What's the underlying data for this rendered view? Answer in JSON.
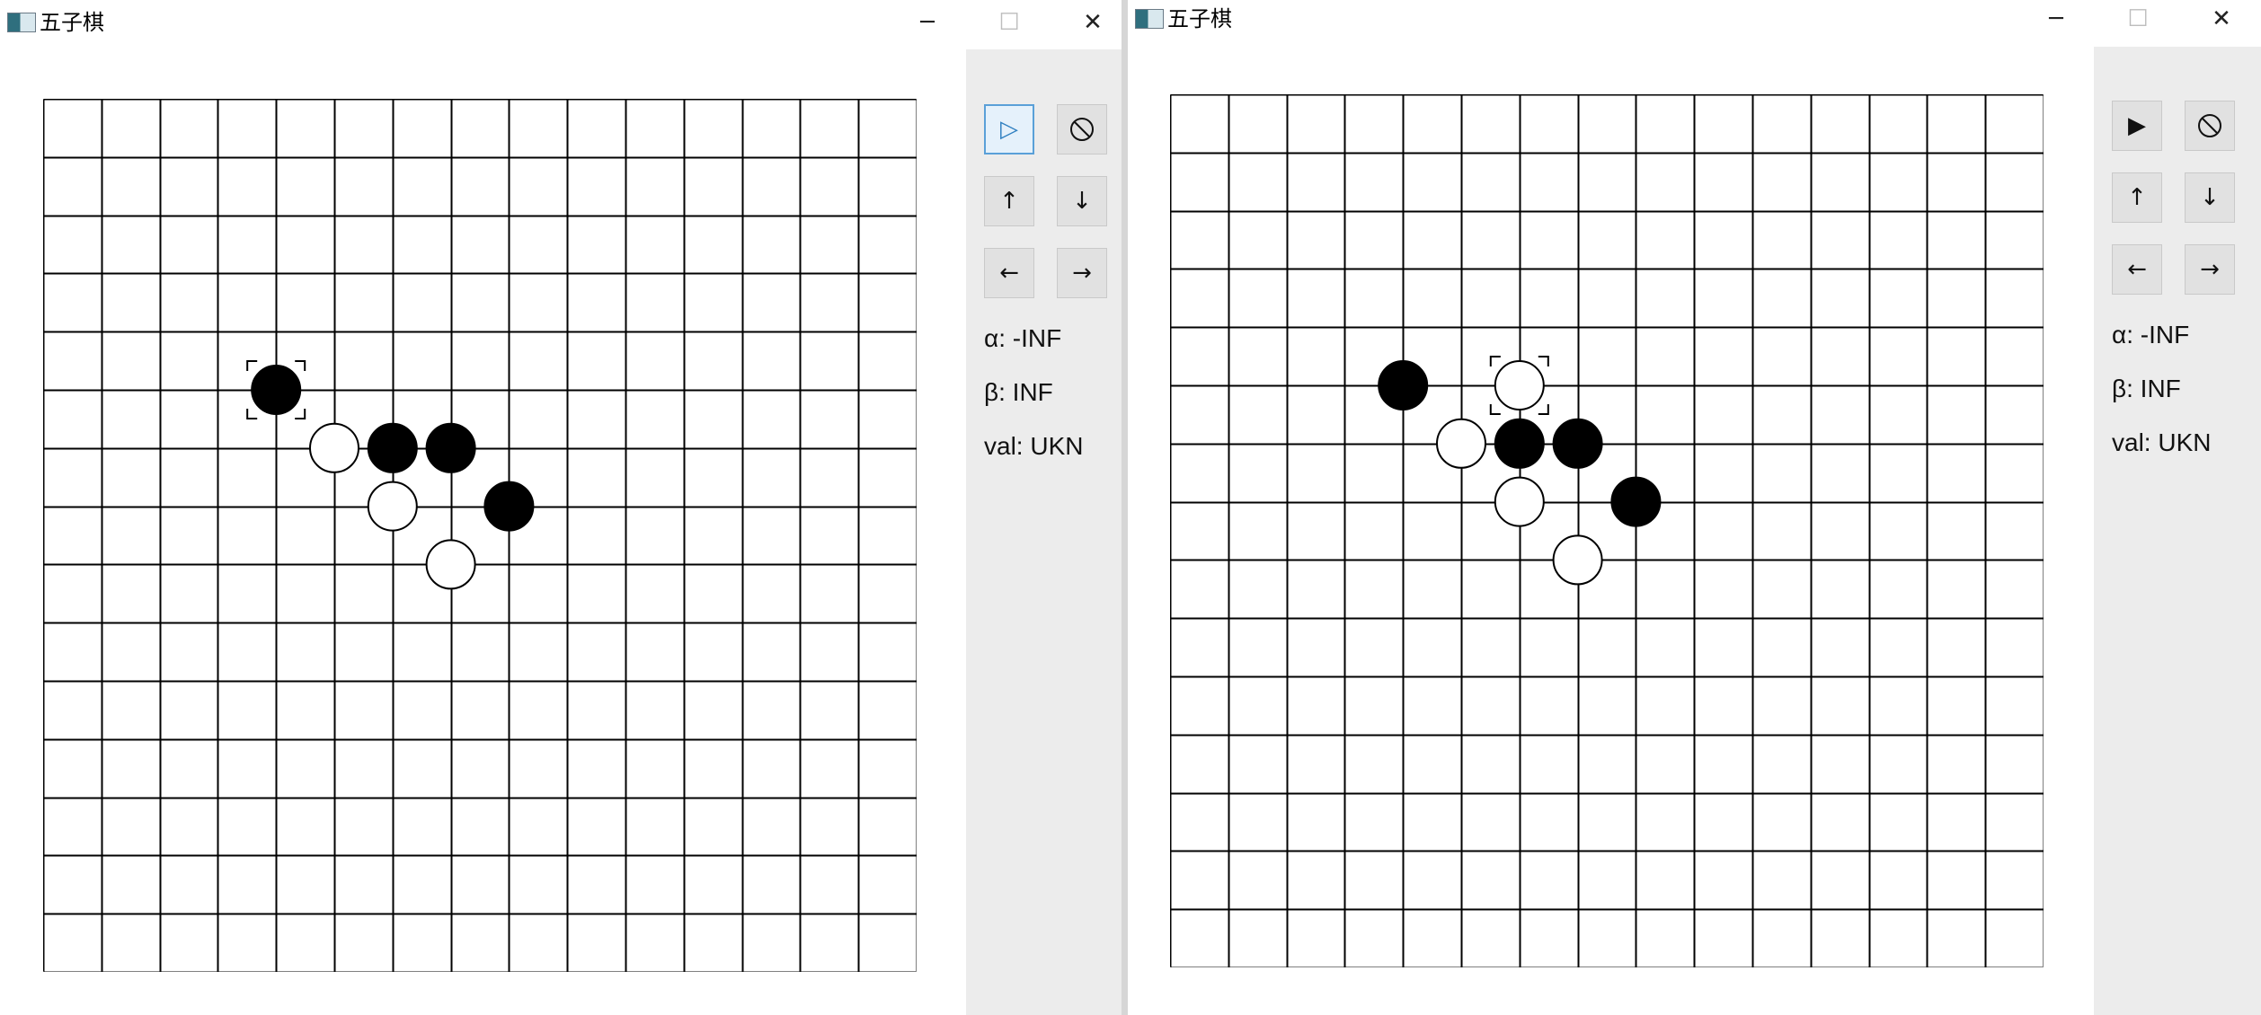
{
  "windows": [
    {
      "title": "五子棋",
      "controls": {
        "minimize": "─",
        "maximize": "☐",
        "close": "✕"
      },
      "panel": {
        "buttons": [
          {
            "name": "play-button",
            "icon": "play-outline-icon",
            "label": "▷",
            "focused": true
          },
          {
            "name": "stop-button",
            "icon": "prohibited-icon",
            "label": "",
            "focused": false
          },
          {
            "name": "up-button",
            "icon": "arrow-up-icon",
            "label": "↑",
            "focused": false
          },
          {
            "name": "down-button",
            "icon": "arrow-down-icon",
            "label": "↓",
            "focused": false
          },
          {
            "name": "left-button",
            "icon": "arrow-left-icon",
            "label": "←",
            "focused": false
          },
          {
            "name": "right-button",
            "icon": "arrow-right-icon",
            "label": "→",
            "focused": false
          }
        ],
        "alpha": "α: -INF",
        "beta": "β: INF",
        "val": "val: UKN"
      },
      "board": {
        "size": 15,
        "stones": [
          {
            "col": 4,
            "row": 5,
            "color": "black"
          },
          {
            "col": 5,
            "row": 6,
            "color": "white"
          },
          {
            "col": 6,
            "row": 6,
            "color": "black"
          },
          {
            "col": 7,
            "row": 6,
            "color": "black"
          },
          {
            "col": 6,
            "row": 7,
            "color": "white"
          },
          {
            "col": 8,
            "row": 7,
            "color": "black"
          },
          {
            "col": 7,
            "row": 8,
            "color": "white"
          }
        ],
        "last_move": {
          "col": 4,
          "row": 5
        }
      }
    },
    {
      "title": "五子棋",
      "controls": {
        "minimize": "─",
        "maximize": "☐",
        "close": "✕"
      },
      "panel": {
        "buttons": [
          {
            "name": "play-button",
            "icon": "play-filled-icon",
            "label": "▶",
            "focused": false
          },
          {
            "name": "stop-button",
            "icon": "prohibited-icon",
            "label": "",
            "focused": false
          },
          {
            "name": "up-button",
            "icon": "arrow-up-icon",
            "label": "↑",
            "focused": false
          },
          {
            "name": "down-button",
            "icon": "arrow-down-icon",
            "label": "↓",
            "focused": false
          },
          {
            "name": "left-button",
            "icon": "arrow-left-icon",
            "label": "←",
            "focused": false
          },
          {
            "name": "right-button",
            "icon": "arrow-right-icon",
            "label": "→",
            "focused": false
          }
        ],
        "alpha": "α: -INF",
        "beta": "β: INF",
        "val": "val: UKN"
      },
      "board": {
        "size": 15,
        "stones": [
          {
            "col": 4,
            "row": 5,
            "color": "black"
          },
          {
            "col": 6,
            "row": 5,
            "color": "white"
          },
          {
            "col": 5,
            "row": 6,
            "color": "white"
          },
          {
            "col": 6,
            "row": 6,
            "color": "black"
          },
          {
            "col": 7,
            "row": 6,
            "color": "black"
          },
          {
            "col": 6,
            "row": 7,
            "color": "white"
          },
          {
            "col": 8,
            "row": 7,
            "color": "black"
          },
          {
            "col": 7,
            "row": 8,
            "color": "white"
          }
        ],
        "last_move": {
          "col": 6,
          "row": 5
        }
      }
    }
  ]
}
